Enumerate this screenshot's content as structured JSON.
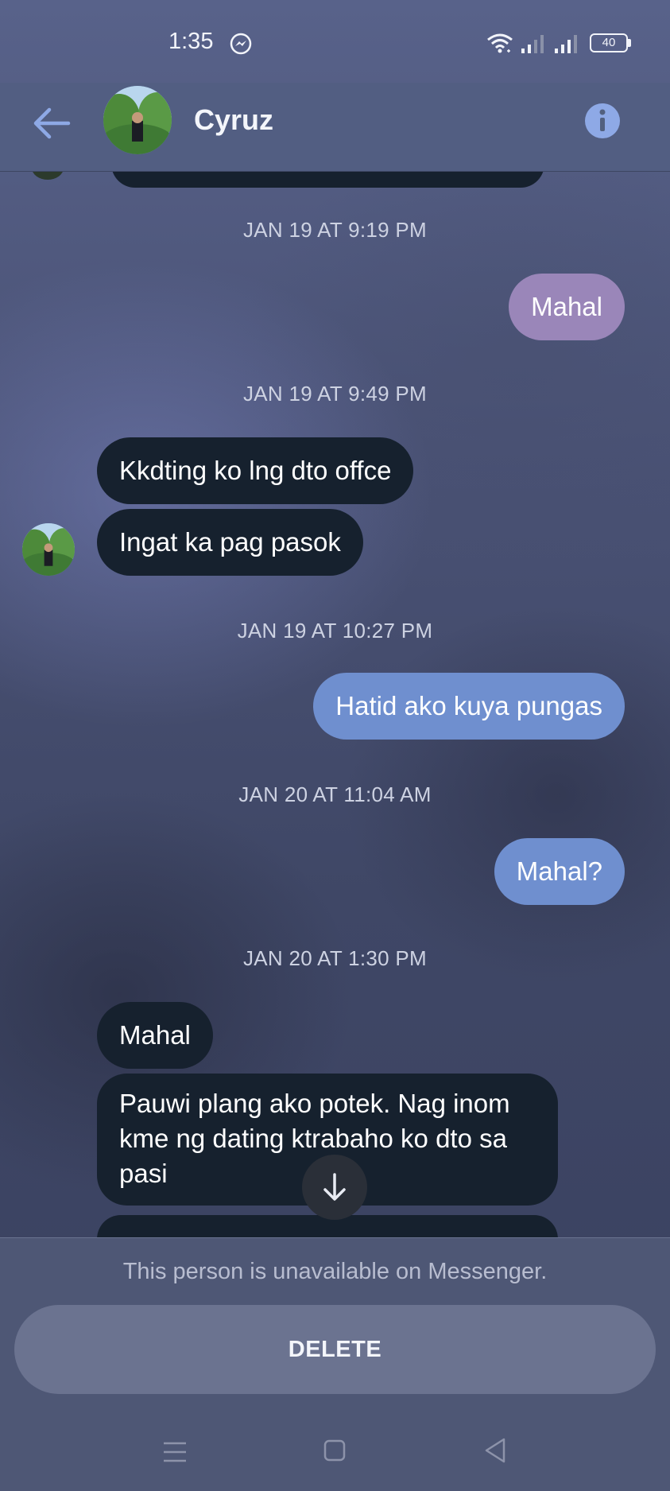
{
  "status_bar": {
    "time": "1:35",
    "battery": "40",
    "icons": [
      "messenger-icon",
      "wifi-icon",
      "signal-icon",
      "signal-icon",
      "battery-icon"
    ]
  },
  "header": {
    "contact_name": "Cyruz",
    "back_icon": "back-arrow-icon",
    "info_icon": "info-icon"
  },
  "messages": [
    {
      "kind": "timestamp",
      "text": "JAN 19 AT 9:19 PM"
    },
    {
      "kind": "outgoing",
      "text": "Mahal"
    },
    {
      "kind": "timestamp",
      "text": "JAN 19 AT 9:49 PM"
    },
    {
      "kind": "incoming",
      "text": "Kkdting ko lng dto offce"
    },
    {
      "kind": "incoming",
      "text": "Ingat ka pag pasok"
    },
    {
      "kind": "timestamp",
      "text": "JAN 19 AT 10:27 PM"
    },
    {
      "kind": "outgoing",
      "text": "Hatid ako kuya pungas"
    },
    {
      "kind": "timestamp",
      "text": "JAN 20 AT 11:04 AM"
    },
    {
      "kind": "outgoing",
      "text": "Mahal?"
    },
    {
      "kind": "timestamp",
      "text": "JAN 20 AT 1:30 PM"
    },
    {
      "kind": "incoming",
      "text": "Mahal"
    },
    {
      "kind": "incoming",
      "text": "Pauwi plang ako potek. Nag inom kme ng dating ktrabaho ko dto sa pasi"
    }
  ],
  "colors": {
    "incoming_bubble": "#16212e",
    "outgoing_purple": "#9a86b9",
    "outgoing_blue": "#6f8fcf"
  },
  "footer": {
    "unavailable_text": "This person is unavailable on Messenger.",
    "delete_label": "DELETE"
  },
  "nav": {
    "icons": [
      "menu-icon",
      "home-icon",
      "back-icon"
    ]
  }
}
